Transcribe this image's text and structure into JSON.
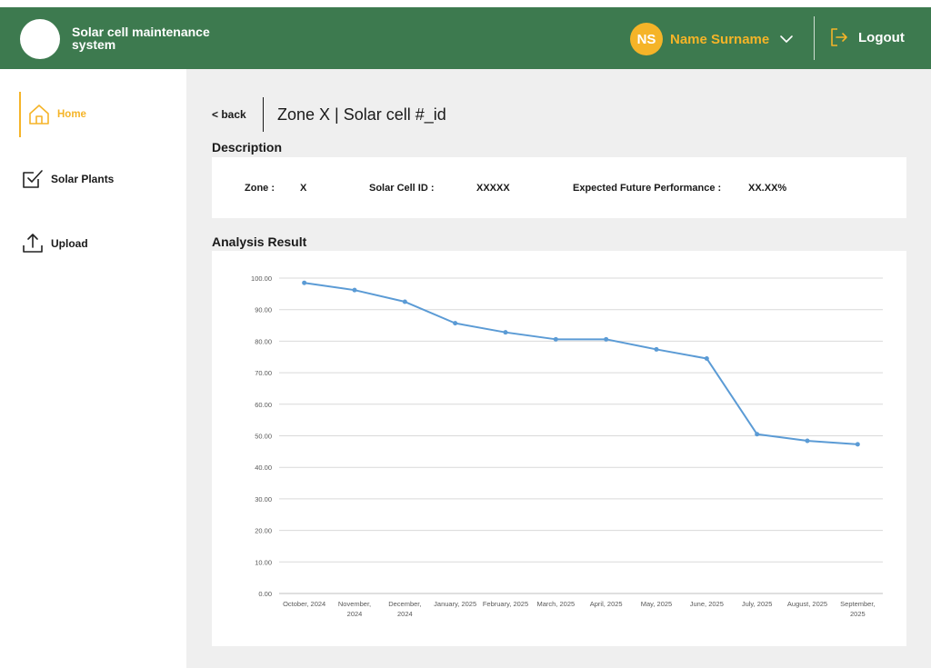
{
  "header": {
    "app_title": "Solar cell maintenance system",
    "user_initials": "NS",
    "user_name": "Name Surname",
    "logout_label": "Logout",
    "accent_color": "#f5b428",
    "header_color": "#3d7a4f"
  },
  "sidebar": {
    "items": [
      {
        "label": "Home",
        "icon": "home-icon",
        "active": true
      },
      {
        "label": "Solar Plants",
        "icon": "checkbox-icon",
        "active": false
      },
      {
        "label": "Upload",
        "icon": "upload-icon",
        "active": false
      }
    ]
  },
  "page": {
    "back_label": "< back",
    "title": "Zone X | Solar cell #_id"
  },
  "description": {
    "heading": "Description",
    "zone_label": "Zone :",
    "zone_value": "X",
    "cell_id_label": "Solar Cell ID :",
    "cell_id_value": "XXXXX",
    "perf_label": "Expected Future Performance :",
    "perf_value": "XX.XX%"
  },
  "analysis": {
    "heading": "Analysis Result"
  },
  "chart_data": {
    "type": "line",
    "categories": [
      "October, 2024",
      "November, 2024",
      "December, 2024",
      "January, 2025",
      "February, 2025",
      "March, 2025",
      "April, 2025",
      "May, 2025",
      "June, 2025",
      "July, 2025",
      "August, 2025",
      "September, 2025"
    ],
    "category_lines": [
      [
        "October, 2024"
      ],
      [
        "November,",
        "2024"
      ],
      [
        "December,",
        "2024"
      ],
      [
        "January, 2025"
      ],
      [
        "February, 2025"
      ],
      [
        "March, 2025"
      ],
      [
        "April, 2025"
      ],
      [
        "May, 2025"
      ],
      [
        "June, 2025"
      ],
      [
        "July, 2025"
      ],
      [
        "August, 2025"
      ],
      [
        "September,",
        "2025"
      ]
    ],
    "values": [
      98.5,
      96.2,
      92.5,
      85.7,
      82.8,
      80.6,
      80.6,
      77.4,
      74.5,
      50.5,
      48.4,
      47.3
    ],
    "yticks": [
      "0.00",
      "10.00",
      "20.00",
      "30.00",
      "40.00",
      "50.00",
      "60.00",
      "70.00",
      "80.00",
      "90.00",
      "100.00"
    ],
    "ylim": [
      0,
      100
    ],
    "grid": true,
    "line_color": "#5b9bd5",
    "title": "",
    "xlabel": "",
    "ylabel": ""
  }
}
